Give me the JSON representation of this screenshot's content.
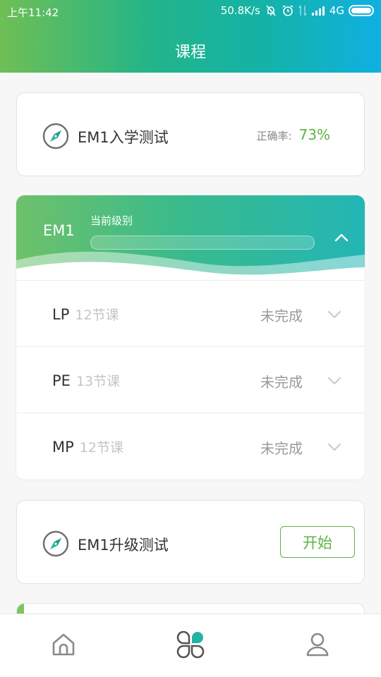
{
  "status_bar": {
    "time": "上午11:42",
    "net_speed": "50.8K/s",
    "network": "4G"
  },
  "header": {
    "title": "课程"
  },
  "entry_test": {
    "title": "EM1入学测试",
    "accuracy_label": "正确率:",
    "accuracy_value": "73%"
  },
  "level": {
    "name": "EM1",
    "subtitle": "当前级别",
    "progress": 0,
    "expanded": true
  },
  "lessons": [
    {
      "name": "LP",
      "count": "12节课",
      "status": "未完成"
    },
    {
      "name": "PE",
      "count": "13节课",
      "status": "未完成"
    },
    {
      "name": "MP",
      "count": "12节课",
      "status": "未完成"
    }
  ],
  "upgrade_test": {
    "title": "EM1升级测试",
    "button_label": "开始"
  },
  "colors": {
    "accent_green": "#5ab544",
    "header_gradient_start": "#6fbf55",
    "header_gradient_end": "#0fb0e3",
    "tab_active_teal": "#23b3a4",
    "tab_active_green": "#6cc05d"
  },
  "tabbar": {
    "tabs": [
      {
        "icon": "home-icon",
        "active": false
      },
      {
        "icon": "courses-icon",
        "active": true
      },
      {
        "icon": "profile-icon",
        "active": false
      }
    ]
  }
}
